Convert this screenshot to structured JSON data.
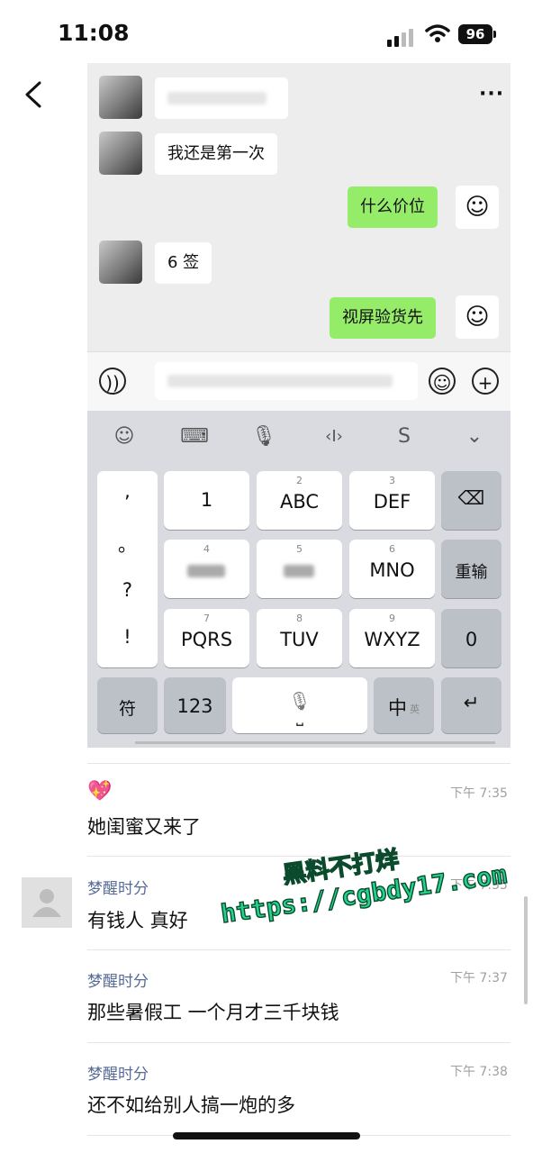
{
  "status_bar": {
    "time": "11:08",
    "battery": "96"
  },
  "chat": {
    "messages": [
      {
        "side": "left",
        "text": ""
      },
      {
        "side": "left",
        "text": "我还是第一次"
      },
      {
        "side": "right",
        "text": "什么价位"
      },
      {
        "side": "left",
        "text": "6 签"
      },
      {
        "side": "right",
        "text": "视屏验货先"
      }
    ],
    "more_icon": "···"
  },
  "keyboard": {
    "punct": [
      ",",
      "。",
      "?",
      "!"
    ],
    "keys": [
      {
        "num": "",
        "label": "1"
      },
      {
        "num": "2",
        "label": "ABC"
      },
      {
        "num": "3",
        "label": "DEF"
      },
      {
        "num": "4",
        "label": ""
      },
      {
        "num": "5",
        "label": ""
      },
      {
        "num": "6",
        "label": "MNO"
      },
      {
        "num": "7",
        "label": "PQRS"
      },
      {
        "num": "8",
        "label": "TUV"
      },
      {
        "num": "9",
        "label": "WXYZ"
      }
    ],
    "right": {
      "retype": "重输",
      "zero": "0"
    },
    "bottom": {
      "symbols": "符",
      "numbers": "123",
      "lang": "中",
      "lang_sub": "英"
    }
  },
  "comments": [
    {
      "author": "",
      "emoji": "💖",
      "time": "下午 7:35",
      "text": "她闺蜜又来了"
    },
    {
      "author": "梦醒时分",
      "time": "下午 7:35",
      "text": "有钱人 真好"
    },
    {
      "author": "梦醒时分",
      "time": "下午 7:37",
      "text": "那些暑假工 一个月才三千块钱"
    },
    {
      "author": "梦醒时分",
      "time": "下午 7:38",
      "text": "还不如给别人搞一炮的多"
    }
  ],
  "watermark": {
    "line1": "黑料不打烊",
    "line2": "https://cgbdy17.com"
  }
}
